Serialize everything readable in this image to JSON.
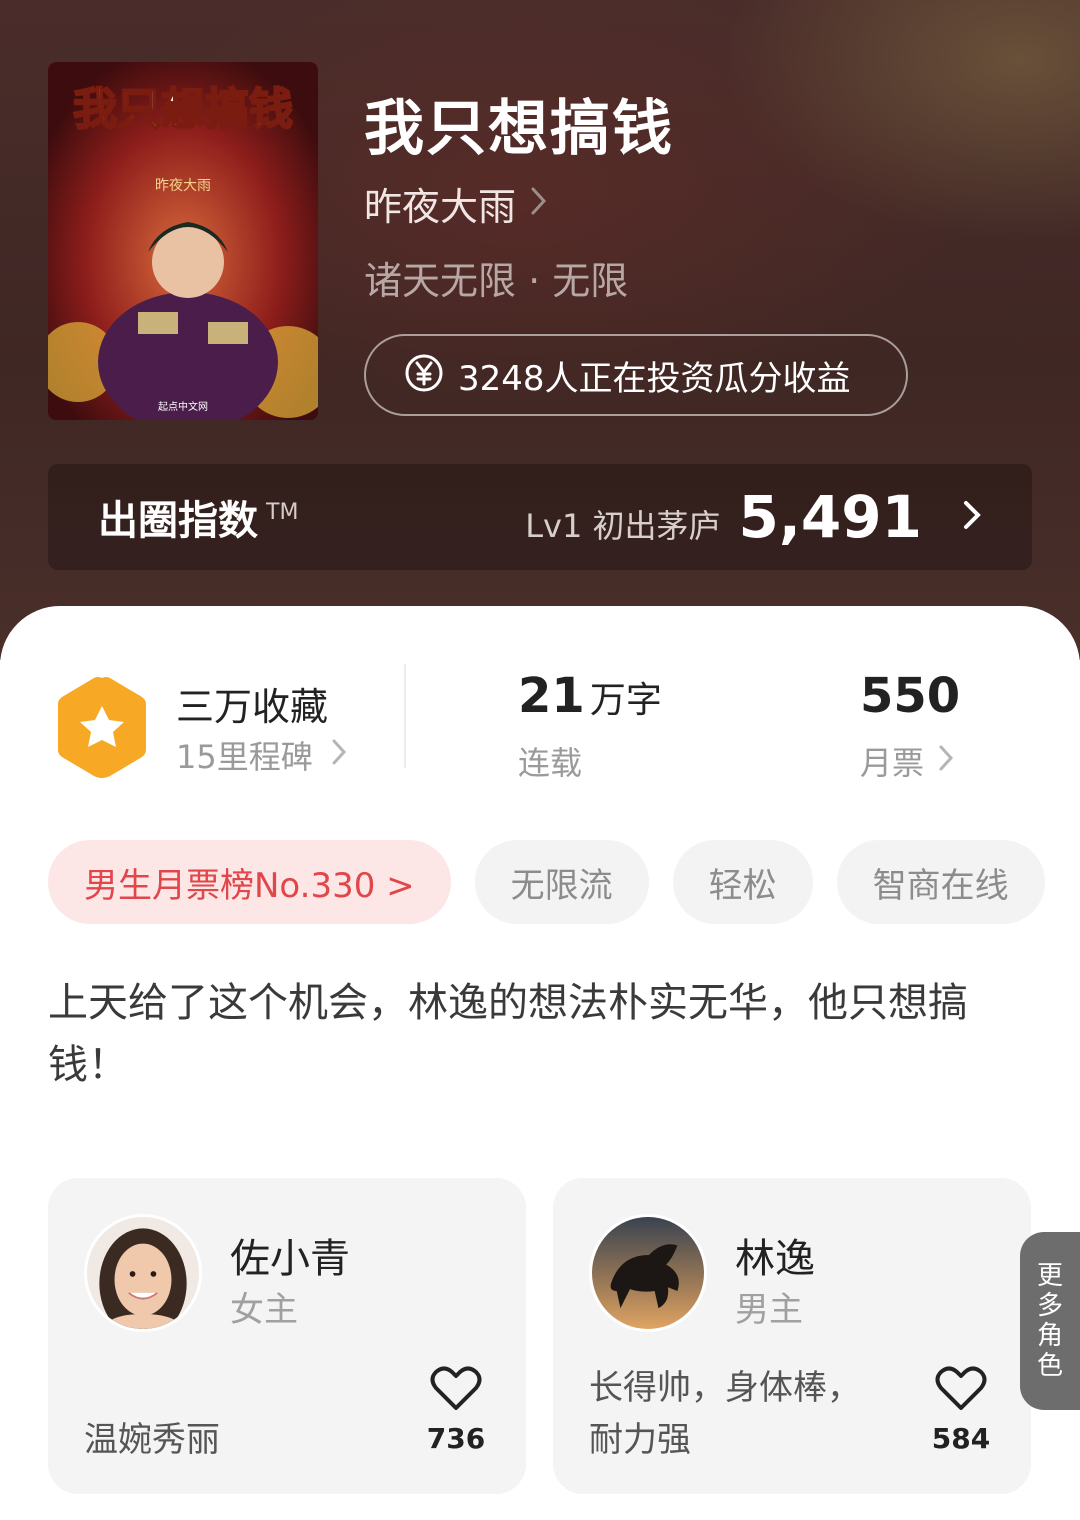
{
  "book": {
    "title": "我只想搞钱",
    "author": "昨夜大雨",
    "genre": "诸天无限 · 无限",
    "cover_title_art": "我只想搞钱",
    "cover_author_art": "昨夜大雨",
    "cover_publisher_art": "起点中文网"
  },
  "invest": {
    "icon": "yen-circle-icon",
    "text": "3248人正在投资瓜分收益"
  },
  "index": {
    "label": "出圈指数",
    "tm": "TM",
    "level": "Lv1 初出茅庐",
    "score": "5,491"
  },
  "stats": {
    "favorites_title": "三万收藏",
    "favorites_sub": "15里程碑",
    "words_number": "21",
    "words_unit": "万字",
    "words_label": "连载",
    "votes_number": "550",
    "votes_label": "月票"
  },
  "tags": [
    "男生月票榜No.330 >",
    "无限流",
    "轻松",
    "智商在线"
  ],
  "description": "上天给了这个机会，林逸的想法朴实无华，他只想搞钱！",
  "characters": [
    {
      "name": "佐小青",
      "role": "女主",
      "desc": "温婉秀丽",
      "likes": "736"
    },
    {
      "name": "林逸",
      "role": "男主",
      "desc": "长得帅，身体棒，耐力强",
      "likes": "584"
    }
  ],
  "more_roles": [
    "更",
    "多",
    "角",
    "色"
  ],
  "colors": {
    "header_bg": "#3f2724",
    "rank_tag_bg": "#fde6e6",
    "rank_tag_text": "#e0464a",
    "star_badge": "#f7a825"
  }
}
